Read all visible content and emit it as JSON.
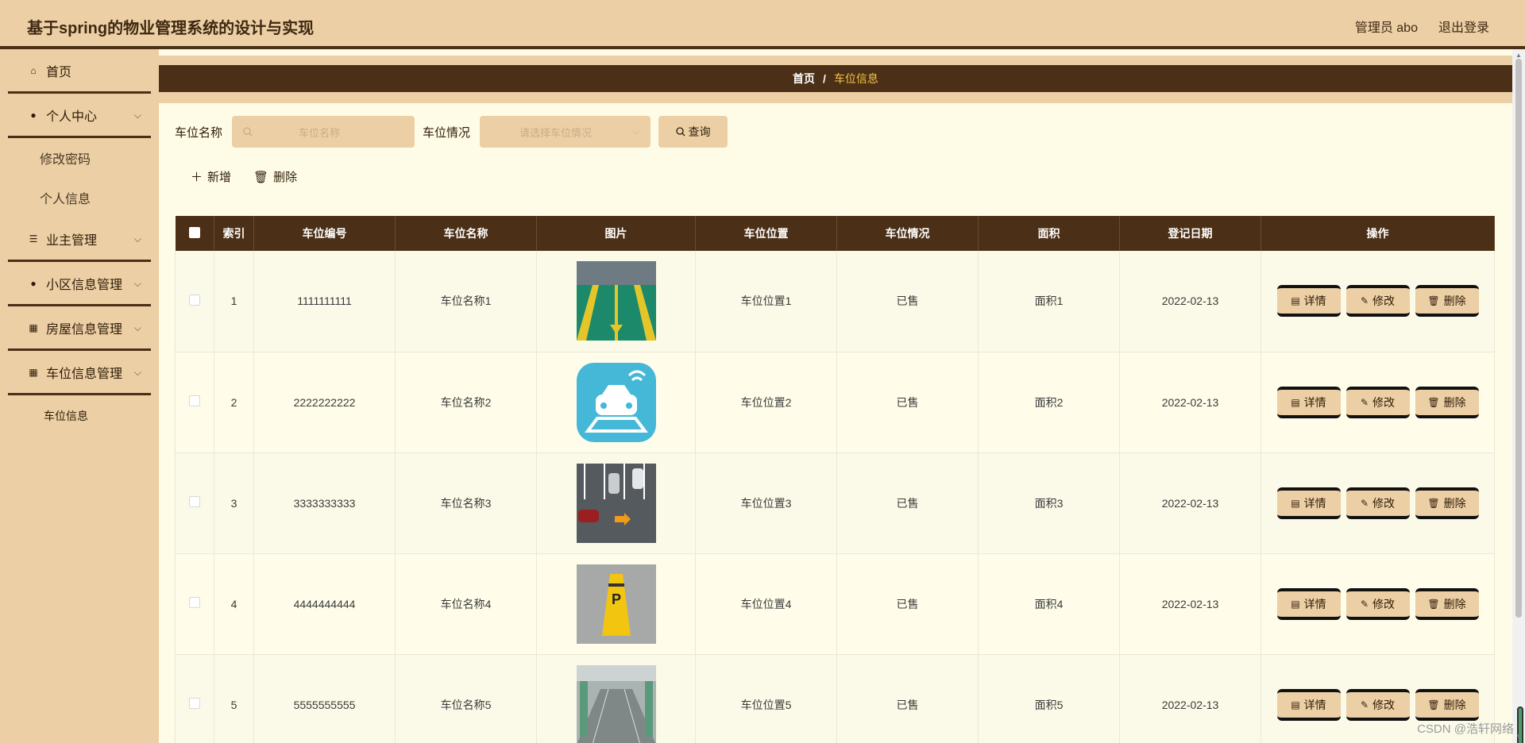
{
  "header": {
    "title": "基于spring的物业管理系统的设计与实现",
    "user": "管理员 abo",
    "logout": "退出登录"
  },
  "sidebar": {
    "home": "首页",
    "personal": "个人中心",
    "change_password": "修改密码",
    "personal_info": "个人信息",
    "owner_mgmt": "业主管理",
    "community_mgmt": "小区信息管理",
    "house_mgmt": "房屋信息管理",
    "parking_mgmt": "车位信息管理",
    "parking_info": "车位信息"
  },
  "breadcrumb": {
    "home": "首页",
    "separator": "/",
    "current": "车位信息"
  },
  "search": {
    "name_label": "车位名称",
    "name_placeholder": "车位名称",
    "status_label": "车位情况",
    "status_placeholder": "请选择车位情况",
    "query": "查询"
  },
  "actions": {
    "add": "新增",
    "delete": "删除"
  },
  "table": {
    "headers": [
      "索引",
      "车位编号",
      "车位名称",
      "图片",
      "车位位置",
      "车位情况",
      "面积",
      "登记日期",
      "操作"
    ],
    "rows": [
      {
        "index": "1",
        "code": "1111111111",
        "name": "车位名称1",
        "location": "车位位置1",
        "status": "已售",
        "area": "面积1",
        "date": "2022-02-13"
      },
      {
        "index": "2",
        "code": "2222222222",
        "name": "车位名称2",
        "location": "车位位置2",
        "status": "已售",
        "area": "面积2",
        "date": "2022-02-13"
      },
      {
        "index": "3",
        "code": "3333333333",
        "name": "车位名称3",
        "location": "车位位置3",
        "status": "已售",
        "area": "面积3",
        "date": "2022-02-13"
      },
      {
        "index": "4",
        "code": "4444444444",
        "name": "车位名称4",
        "location": "车位位置4",
        "status": "已售",
        "area": "面积4",
        "date": "2022-02-13"
      },
      {
        "index": "5",
        "code": "5555555555",
        "name": "车位名称5",
        "location": "车位位置5",
        "status": "已售",
        "area": "面积5",
        "date": "2022-02-13"
      }
    ],
    "op_detail": "详情",
    "op_edit": "修改",
    "op_delete": "删除"
  },
  "watermark": "CSDN @浩轩网络",
  "colors": {
    "header_bg": "#eccfa5",
    "dark_brown": "#4b2f16",
    "content_bg": "#fefce6",
    "highlight": "#f4c64a"
  }
}
